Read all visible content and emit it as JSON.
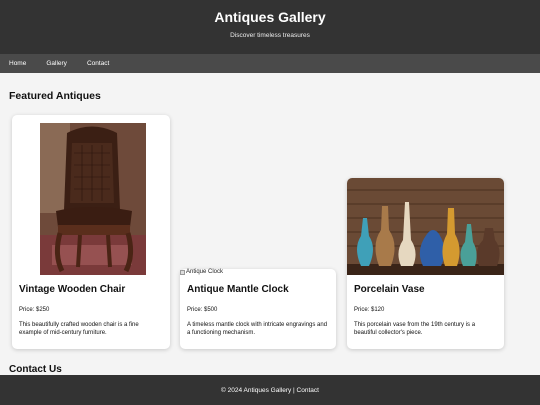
{
  "header": {
    "title": "Antiques Gallery",
    "subtitle": "Discover timeless treasures"
  },
  "nav": [
    {
      "label": "Home"
    },
    {
      "label": "Gallery"
    },
    {
      "label": "Contact"
    }
  ],
  "featured": {
    "title": "Featured Antiques",
    "items": [
      {
        "title": "Vintage Wooden Chair",
        "price": "Price: $250",
        "description": "This beautifully crafted wooden chair is a fine example of mid-century furniture."
      },
      {
        "title": "Antique Mantle Clock",
        "price": "Price: $500",
        "description": "A timeless mantle clock with intricate engravings and a functioning mechanism.",
        "image_alt": "Antique Clock"
      },
      {
        "title": "Porcelain Vase",
        "price": "Price: $120",
        "description": "This porcelain vase from the 19th century is a beautiful collector's piece."
      }
    ]
  },
  "contact": {
    "title": "Contact Us"
  },
  "footer": {
    "text": "© 2024 Antiques Gallery | Contact"
  }
}
